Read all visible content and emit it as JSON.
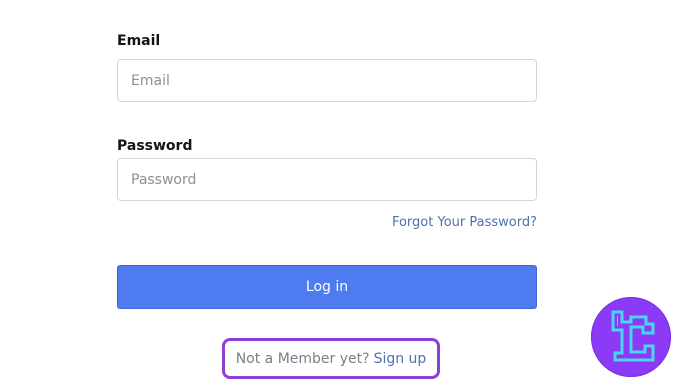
{
  "form": {
    "email_label": "Email",
    "email_placeholder": "Email",
    "email_value": "",
    "password_label": "Password",
    "password_placeholder": "Password",
    "password_value": "",
    "forgot_link": "Forgot Your Password?",
    "login_button": "Log in",
    "signup_prompt": "Not a Member yet?",
    "signup_link": "Sign up"
  },
  "colors": {
    "primary_button": "#4e7bef",
    "link": "#4d72ad",
    "highlight_border": "#8d3ed6",
    "logo_bg": "#8b3bf5",
    "logo_mark": "#49d6f2"
  },
  "icons": {
    "brand_logo": "brand-logo-icon"
  }
}
